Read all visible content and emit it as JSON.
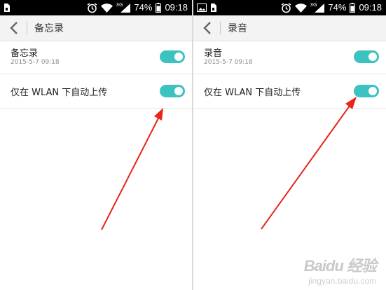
{
  "colors": {
    "accent": "#3cc2c1",
    "arrow": "#e8241b",
    "statusbar": "#000000",
    "titlebar": "#f3f3f3"
  },
  "statusbar": {
    "left_icons_left": [
      "sim-card-icon"
    ],
    "left_icons_right": [
      "image-icon",
      "sim-card-icon"
    ],
    "right_icons": [
      "alarm-icon",
      "wifi-icon",
      "cellular-signal-icon"
    ],
    "network_type": "3G",
    "battery": "74%",
    "time": "09:18"
  },
  "left_panel": {
    "title": "备忘录",
    "rows": [
      {
        "label": "备忘录",
        "sublabel": "2015-5-7 09:18",
        "toggle_on": true
      },
      {
        "label": "仅在 WLAN 下自动上传",
        "toggle_on": true
      }
    ]
  },
  "right_panel": {
    "title": "录音",
    "rows": [
      {
        "label": "录音",
        "sublabel": "2015-5-7 09:18",
        "toggle_on": true
      },
      {
        "label": "仅在 WLAN 下自动上传",
        "toggle_on": true
      }
    ]
  },
  "watermark": {
    "brand": "Baidu 经验",
    "url": "jingyan.baidu.com"
  }
}
